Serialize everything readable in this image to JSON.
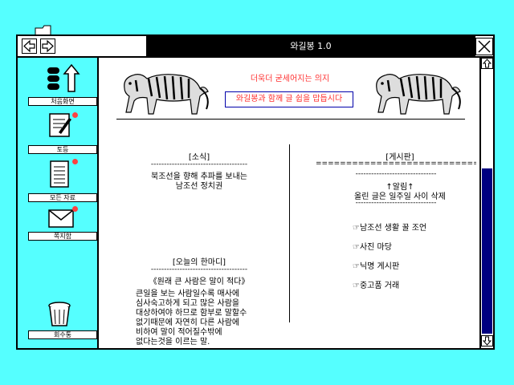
{
  "window": {
    "title": "와길봉 1.0"
  },
  "sidebar": {
    "items": [
      {
        "label": "처음화면",
        "icon": "home-up-icon"
      },
      {
        "label": "토등",
        "icon": "notepad-icon",
        "badge": true
      },
      {
        "label": "모든 자료",
        "icon": "document-icon",
        "badge": true
      },
      {
        "label": "쪽지함",
        "icon": "mail-icon",
        "badge": true
      },
      {
        "label": "회수통",
        "icon": "trash-icon"
      }
    ]
  },
  "header": {
    "slogan": "더욱더 굳세어지는 의지",
    "banner": "와길봉과 함께 글 쉽을 맙듭시다",
    "accent_red": "#ff3030",
    "banner_border": "#0000aa"
  },
  "news": {
    "title": "[소식]",
    "line1": "북조선을 향해 추파를 보내는",
    "line2": "남조선 정치권"
  },
  "quote": {
    "title": "[오늘의 한마디]",
    "heading": "《원래 큰 사람은 말이 적다》",
    "lines": [
      "큰일을 보는 사람일수록 매사에",
      "심사숙고하게 되고 많은 사람을",
      "대상하여야 하므로 함부로 말할수",
      "없기때문에 자연히 다른 사람에",
      "비하여 말이 적어질수밖에",
      "없다는것을 이르는 말."
    ]
  },
  "board": {
    "title": "[게시판]",
    "notice_title": "↑알림↑",
    "notice": "올린 글은 일주일 사이 삭제",
    "links": [
      "☞남조선 생활 꿀 조언",
      "☞사진 마당",
      "☞닉명 게시판",
      "☞중고품 거래"
    ]
  },
  "colors": {
    "desktop": "#55ffff",
    "scroll_thumb": "#000080",
    "title_bar": "#000000"
  }
}
